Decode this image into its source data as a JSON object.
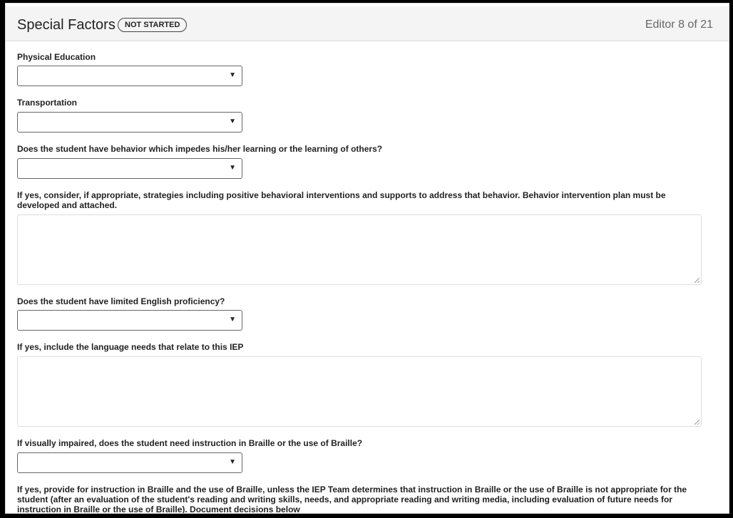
{
  "header": {
    "title": "Special Factors",
    "status_badge": "NOT STARTED",
    "editor_count": "Editor 8 of 21"
  },
  "fields": [
    {
      "label": "Physical Education",
      "type": "select",
      "value": ""
    },
    {
      "label": "Transportation",
      "type": "select",
      "value": ""
    },
    {
      "label": "Does the student have behavior which impedes his/her learning or the learning of others?",
      "type": "select",
      "value": ""
    },
    {
      "label": "If yes, consider, if appropriate, strategies including positive behavioral interventions and supports to address that behavior. Behavior intervention plan must be developed and attached.",
      "type": "textarea",
      "value": ""
    },
    {
      "label": "Does the student have limited English proficiency?",
      "type": "select",
      "value": ""
    },
    {
      "label": "If yes, include the language needs that relate to this IEP",
      "type": "textarea",
      "value": ""
    },
    {
      "label": "If visually impaired, does the student need instruction in Braille or the use of Braille?",
      "type": "select",
      "value": ""
    },
    {
      "label": "If yes, provide for instruction in Braille and the use of Braille, unless the IEP Team determines that instruction in Braille or the use of Braille is not appropriate for the student (after an evaluation of the student's reading and writing skills, needs, and appropriate reading and writing media, including evaluation of future needs for instruction in Braille or the use of Braille). Document decisions below",
      "type": "label",
      "value": ""
    }
  ],
  "icons": {
    "dropdown": "caret-down-icon",
    "resize": "resize-grip-icon"
  }
}
